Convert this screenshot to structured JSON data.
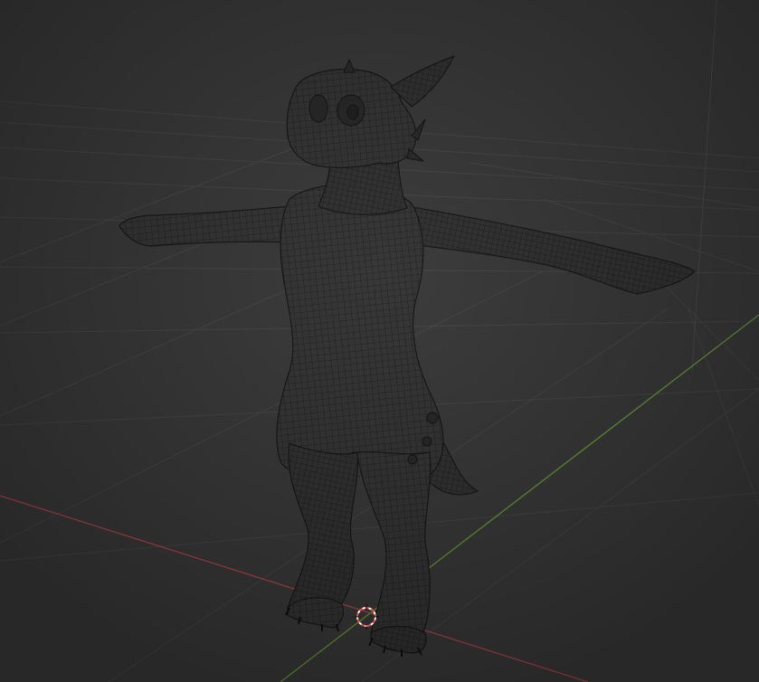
{
  "viewport": {
    "background_color": "#3d3d3d",
    "grid_color": "#4a4a4a",
    "x_axis_color": "#b5484f",
    "y_axis_color": "#6b9d3a",
    "z_axis_color": "#4f4f4f",
    "cursor_color": "#e04a4a",
    "mesh_fill_color": "#363636",
    "wire_color": "#1c1c1c"
  },
  "icons": {
    "cursor": "3d-cursor-icon",
    "model": "character-mesh-icon"
  }
}
